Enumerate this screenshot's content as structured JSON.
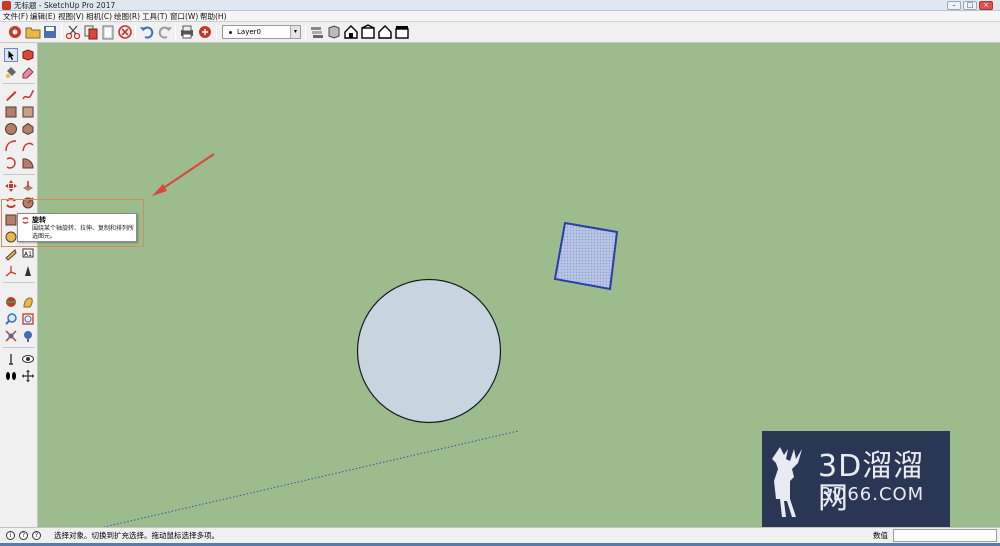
{
  "window": {
    "title": "无标题 - SketchUp Pro 2017",
    "min": "–",
    "max": "□",
    "close": "×"
  },
  "menu": [
    {
      "label": "文件(F)"
    },
    {
      "label": "编辑(E)"
    },
    {
      "label": "视图(V)"
    },
    {
      "label": "相机(C)"
    },
    {
      "label": "绘图(R)"
    },
    {
      "label": "工具(T)"
    },
    {
      "label": "窗口(W)"
    },
    {
      "label": "帮助(H)"
    }
  ],
  "toolbar": {
    "layer_value": "Layer0",
    "layer_arrow": "▾"
  },
  "tooltip": {
    "title": "旋转",
    "description": "围绕某个轴旋转、拉伸、复制和排列所选图元。"
  },
  "statusbar": {
    "info_icon": "i",
    "help_icon": "?",
    "text": "选择对象。切换到扩充选择。拖动鼠标选择多项。",
    "measure_label": "数值",
    "measure_value": ""
  },
  "watermark": {
    "brand": "3D溜溜网",
    "url": "3D66.COM"
  },
  "colors": {
    "canvas": "#9cbc8e",
    "accent_red": "#c8372b",
    "square_edge": "#2a3ea8",
    "square_fill": "#a9b7de",
    "circle_fill": "#c7d5e0",
    "watermark_bg": "#2a3754"
  }
}
